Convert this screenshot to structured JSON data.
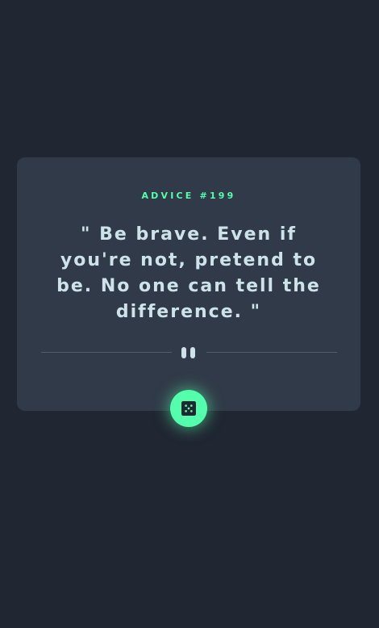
{
  "advice": {
    "label": "ADVICE #199",
    "quote": "\" Be brave. Even if you're not, pretend to be. No one can tell the difference. \""
  },
  "divider": {
    "icon": "pause-icon"
  },
  "dice_button": {
    "icon": "dice-icon"
  },
  "colors": {
    "background": "#202632",
    "card": "#313a48",
    "accent": "#53ffaa",
    "text": "#cee3e9",
    "divider": "#4f5d74"
  }
}
